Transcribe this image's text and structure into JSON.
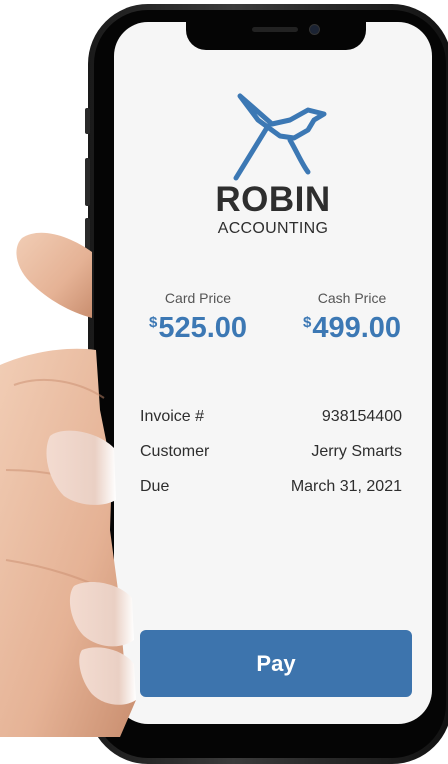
{
  "brand": {
    "name": "ROBIN",
    "subtitle": "ACCOUNTING",
    "color": "#3c78b4"
  },
  "prices": {
    "card": {
      "label": "Card Price",
      "currency": "$",
      "amount": "525.00"
    },
    "cash": {
      "label": "Cash Price",
      "currency": "$",
      "amount": "499.00"
    }
  },
  "details": [
    {
      "label": "Invoice #",
      "value": "938154400"
    },
    {
      "label": "Customer",
      "value": "Jerry Smarts"
    },
    {
      "label": "Due",
      "value": "March 31, 2021"
    }
  ],
  "actions": {
    "pay_label": "Pay",
    "pay_color": "#3d74ad"
  },
  "icons": {
    "logo": "robin-bird-icon"
  }
}
